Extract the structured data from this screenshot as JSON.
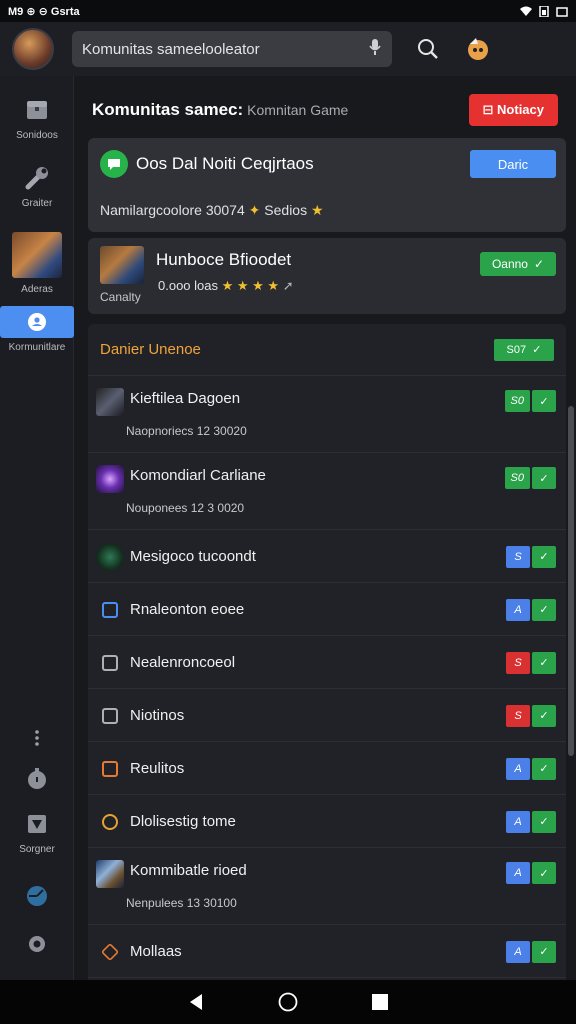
{
  "status_bar": {
    "left_text": "M9 ⊕ ⊖ Gsrta"
  },
  "top_bar": {
    "search_text": "Komunitas sameelooleator"
  },
  "sidebar": {
    "items": [
      {
        "label": "Sonidoos",
        "icon": "chest-icon"
      },
      {
        "label": "Graiter",
        "icon": "wrench-icon"
      },
      {
        "label": "Aderas",
        "icon": "game-avatar-icon"
      },
      {
        "label": "Kormunitlare",
        "icon": "community-icon",
        "active": true
      },
      {
        "label": "",
        "icon": "more-dots-icon"
      },
      {
        "label": "",
        "icon": "lock-icon"
      },
      {
        "label": "Sorgner",
        "icon": "tshirt-icon"
      },
      {
        "label": "",
        "icon": "globe-icon"
      },
      {
        "label": "",
        "icon": "settings-icon"
      }
    ]
  },
  "header": {
    "title": "Komunitas samec:",
    "subtitle": "Komnitan Game",
    "notify_label": "Notiacy"
  },
  "card_chat": {
    "title": "Oos Dal Noiti Ceqjrtaos",
    "button": "Daric",
    "line": "Namilargcoolore 30074",
    "line_suffix": "Sedios"
  },
  "card_game": {
    "title": "Hunboce Bfioodet",
    "stats": "0.ooo loas",
    "label": "Canalty",
    "button": "Oanno"
  },
  "list": {
    "header_label": "Danier Unenoe",
    "header_badge": "S07",
    "rows": [
      {
        "title": "Kieftilea Dagoen",
        "subtitle": "Naopnoriecs 12 30020",
        "badge": "S0",
        "badge_color": "green",
        "icon": "game-thumb-dark-icon"
      },
      {
        "title": "Komondiarl Carliane",
        "subtitle": "Nouponees 12 3 0020",
        "badge": "S0",
        "badge_color": "green",
        "icon": "game-thumb-purple-icon"
      },
      {
        "title": "Mesigoco tucoondt",
        "subtitle": "",
        "badge": "S",
        "badge_color": "blue",
        "icon": "globe-emblem-icon"
      },
      {
        "title": "Rnaleonton eoee",
        "subtitle": "",
        "badge": "A",
        "badge_color": "blue",
        "icon": "edit-icon"
      },
      {
        "title": "Nealenroncoeol",
        "subtitle": "",
        "badge": "S",
        "badge_color": "red",
        "icon": "edit-outline-icon"
      },
      {
        "title": "Niotinos",
        "subtitle": "",
        "badge": "S",
        "badge_color": "red",
        "icon": "edit-outline-icon"
      },
      {
        "title": "Reulitos",
        "subtitle": "",
        "badge": "A",
        "badge_color": "blue",
        "icon": "edit-orange-icon"
      },
      {
        "title": "Dlolisestig tome",
        "subtitle": "",
        "badge": "A",
        "badge_color": "blue",
        "icon": "circle-orange-icon"
      },
      {
        "title": "Kommibatle rioed",
        "subtitle": "Nenpulees 13 30100",
        "badge": "A",
        "badge_color": "blue",
        "icon": "game-thumb-blue-icon"
      },
      {
        "title": "Mollaas",
        "subtitle": "",
        "badge": "A",
        "badge_color": "blue",
        "icon": "hexagon-orange-icon"
      }
    ]
  },
  "colors": {
    "accent_blue": "#4a8ef2",
    "accent_red": "#e63131",
    "accent_green": "#2aa34a",
    "accent_orange": "#f1a33a"
  }
}
